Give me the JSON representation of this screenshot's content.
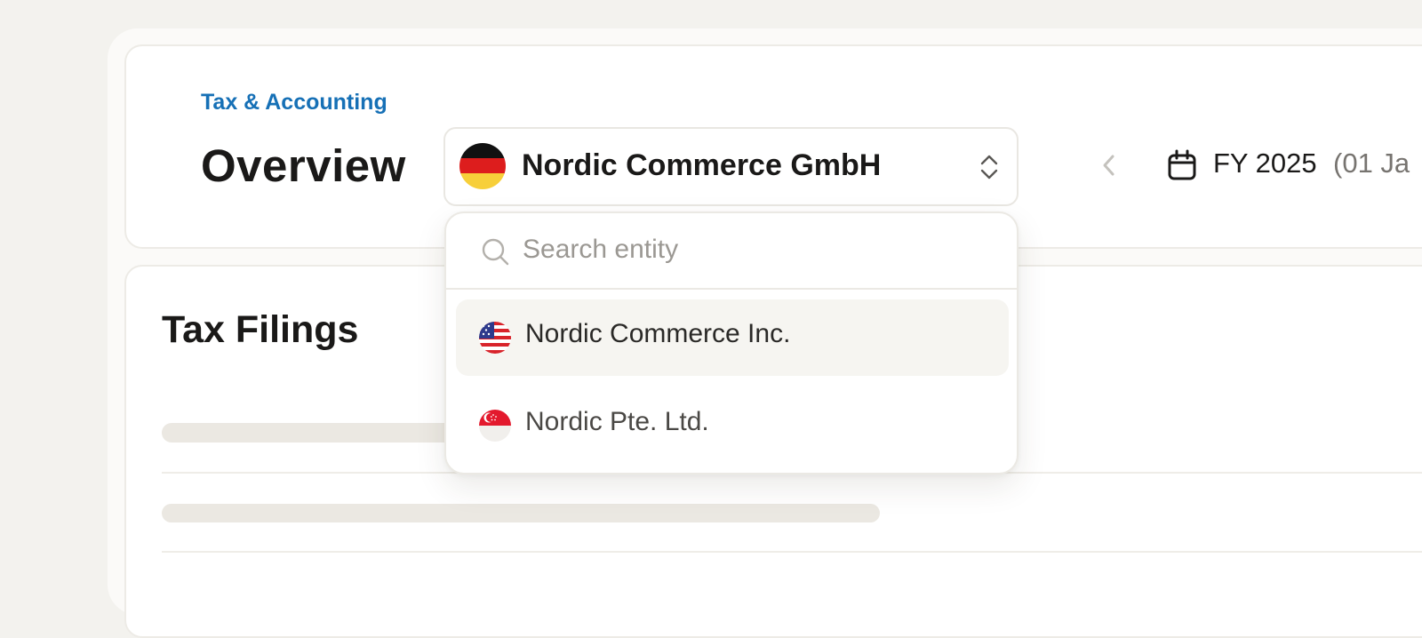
{
  "header": {
    "breadcrumb": "Tax & Accounting",
    "title": "Overview",
    "entity_select": {
      "selected": "Nordic Commerce GmbH",
      "selected_flag": "germany-flag"
    },
    "fiscal_year": {
      "label": "FY 2025",
      "range": "(01 Ja"
    }
  },
  "dropdown": {
    "search_placeholder": "Search entity",
    "options": [
      {
        "label": "Nordic Commerce Inc.",
        "flag": "usa-flag",
        "highlighted": true
      },
      {
        "label": "Nordic Pte. Ltd.",
        "flag": "singapore-flag",
        "highlighted": false
      }
    ]
  },
  "filings": {
    "title": "Tax Filings"
  },
  "colors": {
    "accent": "#1670b6",
    "background": "#f3f2ee",
    "skeleton": "#ebe8e2",
    "option_highlight": "#f6f5f1"
  }
}
